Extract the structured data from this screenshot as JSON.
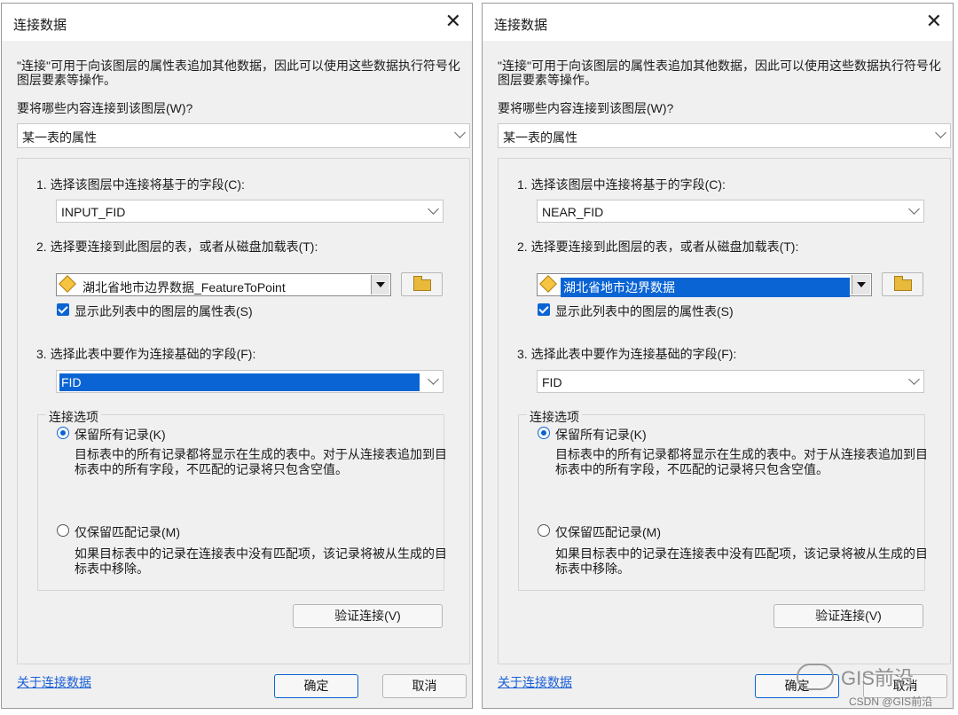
{
  "dialogs": [
    {
      "title": "连接数据",
      "close": "✕",
      "description": "\"连接\"可用于向该图层的属性表追加其他数据，因此可以使用这些数据执行符号化图层要素等操作。",
      "question": "要将哪些内容连接到该图层(W)?",
      "join_type": "某一表的属性",
      "step1_label": "1. 选择该图层中连接将基于的字段(C):",
      "step1_value": "INPUT_FID",
      "step2_label": "2. 选择要连接到此图层的表，或者从磁盘加载表(T):",
      "table_value": "湖北省地市边界数据_FeatureToPoint",
      "show_layers_label": "显示此列表中的图层的属性表(S)",
      "step3_label": "3. 选择此表中要作为连接基础的字段(F):",
      "step3_value": "FID",
      "options_title": "连接选项",
      "keep_all_label": "保留所有记录(K)",
      "keep_all_desc": "目标表中的所有记录都将显示在生成的表中。对于从连接表追加到目标表中的所有字段，不匹配的记录将只包含空值。",
      "keep_matching_label": "仅保留匹配记录(M)",
      "keep_matching_desc": "如果目标表中的记录在连接表中没有匹配项，该记录将被从生成的目标表中移除。",
      "verify_label": "验证连接(V)",
      "about_label": "关于连接数据",
      "ok_label": "确定",
      "cancel_label": "取消"
    },
    {
      "title": "连接数据",
      "close": "✕",
      "description": "\"连接\"可用于向该图层的属性表追加其他数据，因此可以使用这些数据执行符号化图层要素等操作。",
      "question": "要将哪些内容连接到该图层(W)?",
      "join_type": "某一表的属性",
      "step1_label": "1. 选择该图层中连接将基于的字段(C):",
      "step1_value": "NEAR_FID",
      "step2_label": "2. 选择要连接到此图层的表，或者从磁盘加载表(T):",
      "table_value": "湖北省地市边界数据",
      "show_layers_label": "显示此列表中的图层的属性表(S)",
      "step3_label": "3. 选择此表中要作为连接基础的字段(F):",
      "step3_value": "FID",
      "options_title": "连接选项",
      "keep_all_label": "保留所有记录(K)",
      "keep_all_desc": "目标表中的所有记录都将显示在生成的表中。对于从连接表追加到目标表中的所有字段，不匹配的记录将只包含空值。",
      "keep_matching_label": "仅保留匹配记录(M)",
      "keep_matching_desc": "如果目标表中的记录在连接表中没有匹配项，该记录将被从生成的目标表中移除。",
      "verify_label": "验证连接(V)",
      "about_label": "关于连接数据",
      "ok_label": "确定",
      "cancel_label": "取消"
    }
  ],
  "watermark": {
    "brand": "GIS前沿",
    "credit": "CSDN @GIS前沿"
  },
  "colors": {
    "selection": "#0a64d4",
    "link": "#1a5fd6",
    "dialog_bg": "#f0f0f0"
  }
}
